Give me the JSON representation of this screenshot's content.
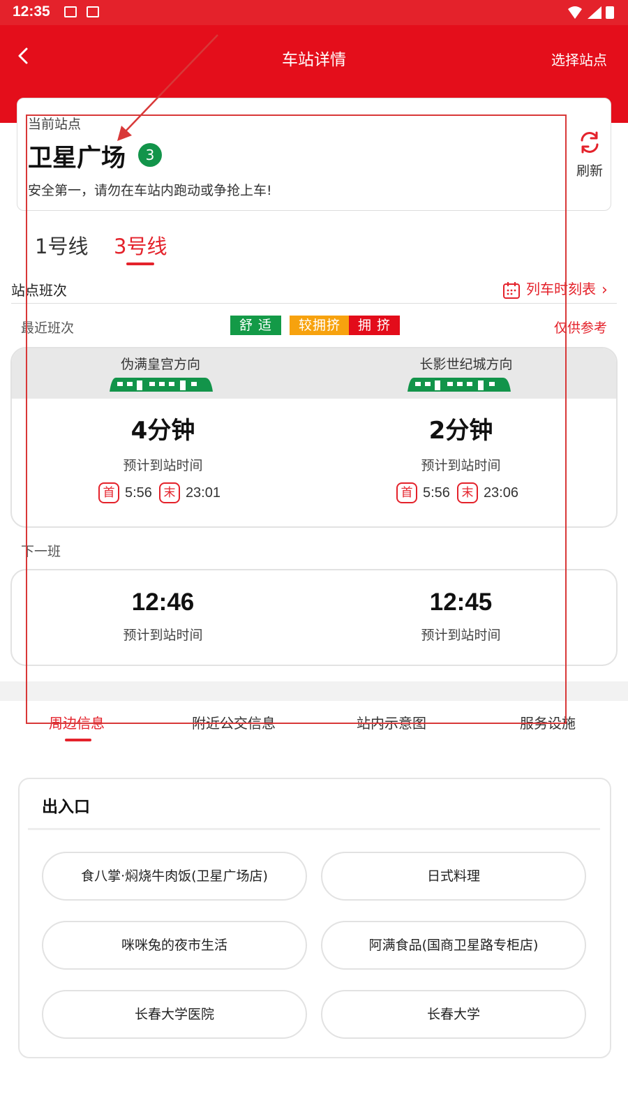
{
  "status_bar": {
    "time": "12:35"
  },
  "header": {
    "title": "车站详情",
    "right_action": "选择站点"
  },
  "station": {
    "current_label": "当前站点",
    "name": "卫星广场",
    "line_badge": "3",
    "safety_tip": "安全第一，请勿在车站内跑动或争抢上车!",
    "refresh_label": "刷新"
  },
  "line_tabs": [
    "1号线",
    "3号线"
  ],
  "schedule": {
    "section_label": "站点班次",
    "timetable_link": "列车时刻表",
    "recent_label": "最近班次",
    "legend": [
      "舒 适",
      "较拥挤",
      "拥 挤"
    ],
    "reference_note": "仅供参考",
    "directions": [
      {
        "name": "伪满皇宫方向",
        "minutes": "4分钟",
        "eta_label": "预计到站时间",
        "first_badge": "首",
        "first": "5:56",
        "last_badge": "末",
        "last": "23:01",
        "next_time": "12:46"
      },
      {
        "name": "长影世纪城方向",
        "minutes": "2分钟",
        "eta_label": "预计到站时间",
        "first_badge": "首",
        "first": "5:56",
        "last_badge": "末",
        "last": "23:06",
        "next_time": "12:45"
      }
    ],
    "next_label": "下一班"
  },
  "bottom_tabs": [
    "周边信息",
    "附近公交信息",
    "站内示意图",
    "服务设施"
  ],
  "exits": {
    "title": "出入口",
    "items": [
      "食八掌·焖烧牛肉饭(卫星广场店)",
      "日式料理",
      "咪咪兔的夜市生活",
      "阿满食品(国商卫星路专柜店)",
      "长春大学医院",
      "长春大学"
    ]
  },
  "colors": {
    "brand_red": "#e40e1b",
    "line3_green": "#12944a",
    "comfort": "#139a47",
    "busy": "#f7a20e",
    "crowded": "#e30c1a"
  }
}
